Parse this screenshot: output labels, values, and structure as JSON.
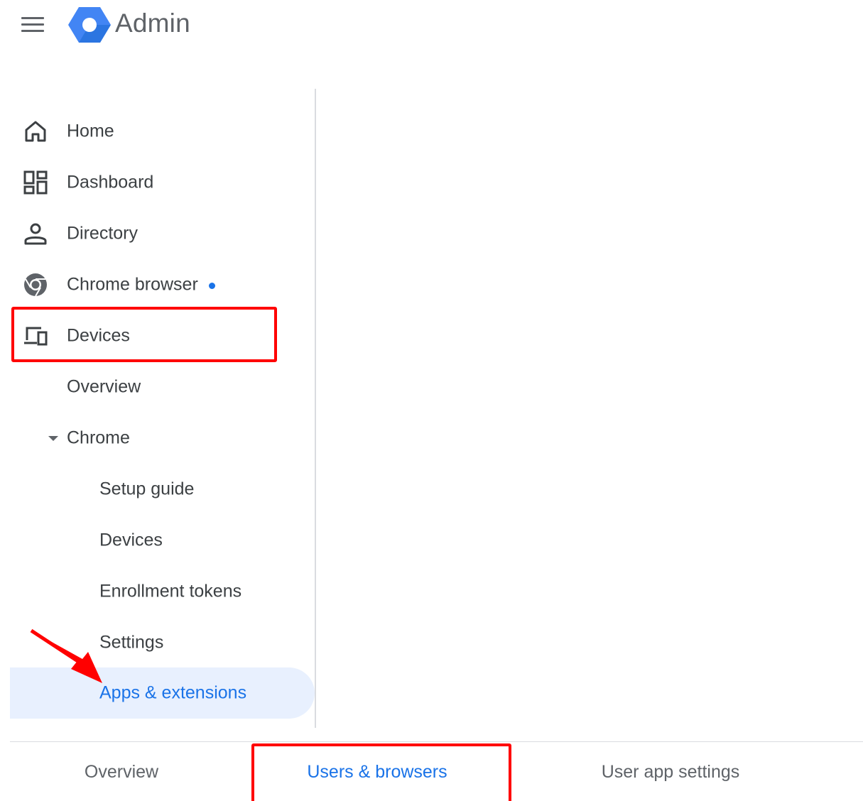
{
  "header": {
    "app_title": "Admin",
    "menu_icon": "hamburger-menu-icon",
    "logo_icon": "google-admin-hexagon-logo",
    "logo_colors": [
      "#4285f4",
      "#1967d2",
      "#ffffff"
    ]
  },
  "sidebar": {
    "items": [
      {
        "label": "Home",
        "icon": "home-icon"
      },
      {
        "label": "Dashboard",
        "icon": "dashboard-icon"
      },
      {
        "label": "Directory",
        "icon": "person-icon"
      },
      {
        "label": "Chrome browser",
        "icon": "chrome-icon",
        "badge": "notification-dot"
      },
      {
        "label": "Devices",
        "icon": "devices-icon"
      },
      {
        "label": "Overview"
      },
      {
        "label": "Chrome",
        "icon": "caret-down-icon"
      },
      {
        "label": "Setup guide"
      },
      {
        "label": "Devices"
      },
      {
        "label": "Enrollment tokens"
      },
      {
        "label": "Settings"
      },
      {
        "label": "Apps & extensions",
        "selected": true
      }
    ]
  },
  "tabs": [
    {
      "label": "Overview"
    },
    {
      "label": "Users & browsers",
      "selected": true
    },
    {
      "label": "User app settings"
    }
  ],
  "colors": {
    "accent": "#1a73e8",
    "selected_bg": "#e8f0fe",
    "annotation": "#ff0000",
    "text": "#3c4043",
    "divider": "#dadce0"
  }
}
